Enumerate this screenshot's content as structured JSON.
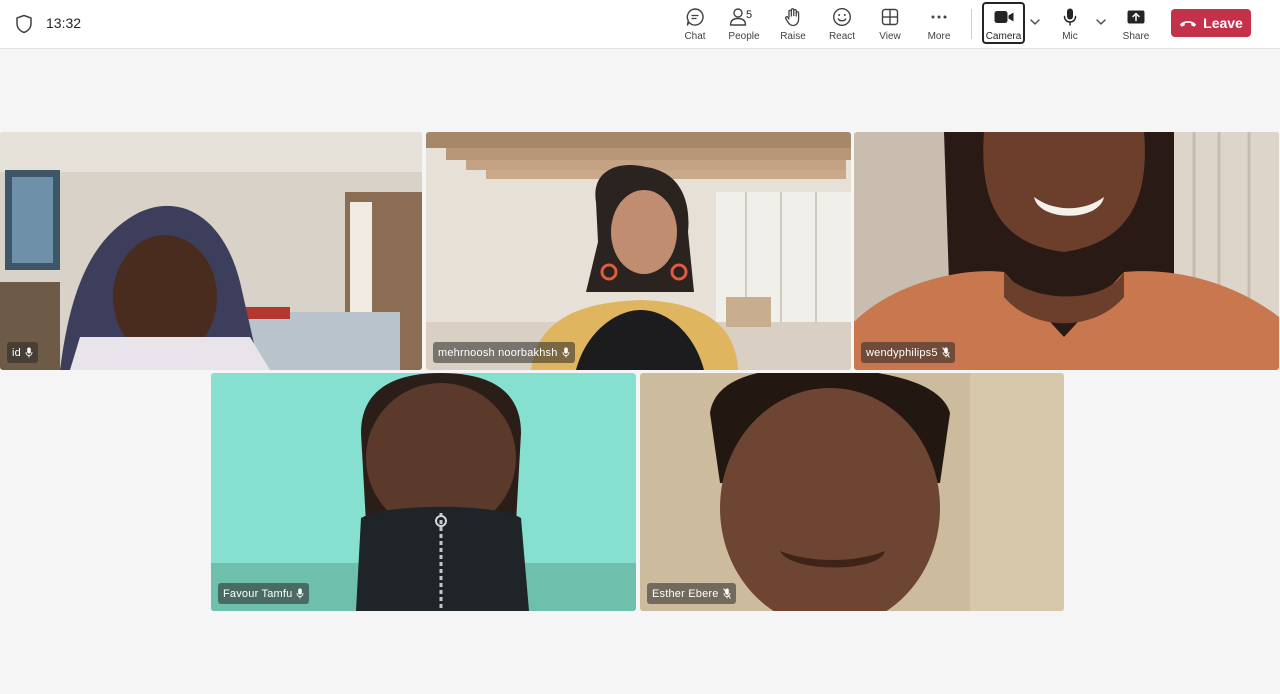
{
  "header": {
    "time": "13:32",
    "people_count": "5",
    "tools": [
      {
        "label": "Chat",
        "icon": "chat-icon"
      },
      {
        "label": "People",
        "icon": "people-icon"
      },
      {
        "label": "Raise",
        "icon": "raise-hand-icon"
      },
      {
        "label": "React",
        "icon": "react-smiley-icon"
      },
      {
        "label": "View",
        "icon": "view-grid-icon"
      },
      {
        "label": "More",
        "icon": "more-dots-icon"
      },
      {
        "label": "Camera",
        "icon": "camera-icon"
      },
      {
        "label": "Mic",
        "icon": "mic-icon"
      },
      {
        "label": "Share",
        "icon": "share-icon"
      }
    ],
    "leave_label": "Leave"
  },
  "participants": [
    {
      "name": "id",
      "mic": "on",
      "background": "#cfc6bb"
    },
    {
      "name": "mehrnoosh noorbakhsh",
      "mic": "on",
      "background": "#e4ddd2"
    },
    {
      "name": "wendyphilips5",
      "mic": "muted",
      "background": "#b98a6c"
    },
    {
      "name": "Favour Tamfu",
      "mic": "on",
      "background": "#86e0cf"
    },
    {
      "name": "Esther Ebere",
      "mic": "muted",
      "background": "#c9b597"
    }
  ],
  "colors": {
    "leave": "#c4314b",
    "stage": "#f5f5f5",
    "toolbar": "#ffffff"
  }
}
